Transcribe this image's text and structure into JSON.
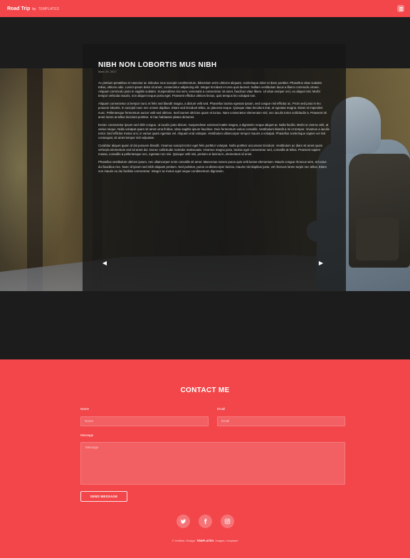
{
  "nav": {
    "title": "Road Trip",
    "by": "by",
    "author": "TEMPLATED"
  },
  "post": {
    "title": "NIBH NON LOBORTIS MUS NIBH",
    "date": "Mars 29, 2017",
    "paragraphs": [
      "Ac pretium penatibus et nascetur ac ridiculus mus suscipit condimentum, bibendum enim ultricies aliquam, scelerisque dolor et diam porttitor. Phasellus vitae sodales tellus, ultrices odio. Lorem ipsum dolor sit amet, consectetur adipiscing elit. Integer tincidunt et urna quis laoreet. Nullam vestibulum lacus a libero commodo ornare. Aliquam commodo justo in sagittis sodales. Suspendisse nisi sem, venenatis a consectetur sit amet, faucibus vitae libero. Ut vitae semper orci, eu aliquet nisl. Morbi tempor vehicula mauris, non aliquet neque porta eget. Praesent efficitur ultrices lectus, quis tempus leo volutpat non.",
      "Aliquam consectetur ut tempor nunc et felis sed blandit magna, a dictum velit sed. Phasellus lacinia egestas ipsum, sed congue nisl efficitur ac. Proin sed justo in leo posuere lobortis. In suscipit nunc nec ornare dapibus. Etiam sed tincidunt tellus, ac placerat neque. Quisque vitae tincidunt erat, et egestas magna. Etiam et imperdiet nunc. Pellentesque fermentum auctor velit sed ultrices. Sed laoreet ultricies quam et luctus. Nam consectetur elementum nisl, nec iaculis tortor sollicitudin a. Praesent sit amet lorem at tellus tincidunt porttitor. In hac habitasse platea dictumst.",
      "Donec consectetur ipsum sed nibh congue, ut iaculis justo dictum. Suspendisse euismod mattis magna, a dignissim neque aliquet at. Nulla facilisi. Morbi ut viverra velit, at varius neque. Nulla volutpat quam sit amet urna finibus, vitae sagittis ipsum faucibus. Duis fermentum varius convallis. Vestibulum blandit a mi et tempor. Vivamus a iaculis tortor. Sed efficitur metus orci, in varius quam egestas vel. Aliquam erat volutpat. Vestibulum ullamcorper tempor mauris a volutpat. Phasellus scelerisque sapien vel nisl consequat, sit amet tempor nisl vulputate.",
      "Curabitur aliquet quam id dui posuere blandit. Vivamus suscipit tortor eget felis porttitor volutpat. Nulla porttitor accumsan tincidunt. Vestibulum ac diam sit amet quam vehicula elementum sed sit amet dui. Donec sollicitudin molestie malesuada. Vivamus magna justo, lacinia eget consectetur sed, convallis at tellus. Praesent sapien massa, convallis a pellentesque nec, egestas non nisi. Quisque velit nisi, pretium ut lacinia in, elementum id enim.",
      "Phasellus vestibulum ultrices ipsum, nec ullamcorper enim convallis sit amet. Maecenas rutrum purus quis velit luctus elementum. Mauris congue rhoncus sem, at luctus dui faucibus nec. Nunc id ipsum sed nibh aliquam pretium. Sed pulvinar, purus ut ullamcorper lacinia, mauris nisl dapibus justo, vel rhoncus lorem turpis nec tellus. Etiam non mauris eu dui facilisis consectetur. Integer ac metus eget neque condimentum dignissim."
    ]
  },
  "contact": {
    "heading": "CONTACT ME",
    "name_label": "Name",
    "name_placeholder": "Name",
    "email_label": "Email",
    "email_placeholder": "Email",
    "message_label": "Message",
    "message_placeholder": "Message",
    "send_label": "SEND MESSAGE"
  },
  "social": [
    {
      "icon": "twitter-icon"
    },
    {
      "icon": "facebook-icon"
    },
    {
      "icon": "instagram-icon"
    }
  ],
  "footer": {
    "prefix": "© Untitled. Design:",
    "brand": "TEMPLATED",
    "suffix": ". Images: Unsplash"
  },
  "colors": {
    "accent": "#f2464a",
    "dark": "#1c1c1c"
  }
}
